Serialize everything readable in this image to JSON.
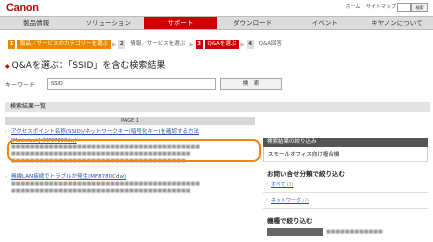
{
  "header": {
    "logo": "Canon",
    "links": [
      "ホーム",
      "サイトマップ"
    ],
    "search_btn": "検索"
  },
  "nav": {
    "items": [
      "製品情報",
      "ソリューション",
      "サポート",
      "ダウンロード",
      "イベント",
      "キヤノンについて"
    ],
    "active_index": 2
  },
  "steps": [
    {
      "num": "1",
      "label": "製品／サービスのカテゴリーを選ぶ"
    },
    {
      "num": "2",
      "label": "情報／サービスを選ぶ"
    },
    {
      "num": "3",
      "label": "Q&Aを選ぶ"
    },
    {
      "num": "4",
      "label": "Q&A回答"
    }
  ],
  "page_title": "Q&Aを選ぶ：「SSID」を含む検索結果",
  "keyword": {
    "label": "キーワード",
    "value": "SSID",
    "button": "検　索"
  },
  "results_header": "検索結果一覧",
  "page_label": "PAGE 1",
  "results": [
    {
      "title": "アクセスポイント名称(SSID)/ネットワークキー(暗号化キー)を確認する方法",
      "sub": "[Macintosh] (MF8780Cdw)"
    },
    {
      "title": "無線LAN接続でトラブルが発生(MF8780Cdw)",
      "sub": ""
    }
  ],
  "sidebar": {
    "header": "検索結果の絞り込み",
    "scope": "スモールオフィス向け複合機",
    "cat_title": "お問い合せ分類で絞り込む",
    "links": [
      {
        "label": "すべて",
        "count": "(7)"
      },
      {
        "label": "ネットワーク",
        "count": "(7)"
      }
    ],
    "bottom_title": "機種で絞り込む"
  }
}
